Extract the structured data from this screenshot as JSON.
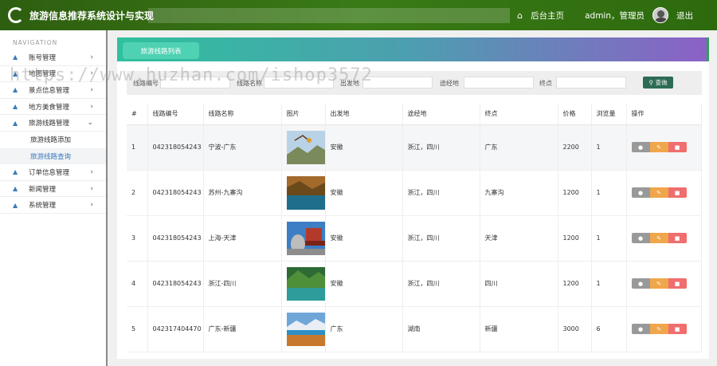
{
  "app": {
    "title": "旅游信息推荐系统设计与实现"
  },
  "topnav": {
    "home_label": "后台主页",
    "user_label": "admin，管理员",
    "logout_label": "退出"
  },
  "sidebar": {
    "nav_title": "NAVIGATION",
    "items": [
      {
        "label": "账号管理"
      },
      {
        "label": "地图管理"
      },
      {
        "label": "景点信息管理"
      },
      {
        "label": "地方美食管理"
      },
      {
        "label": "旅游线路管理"
      }
    ],
    "subitems": [
      {
        "label": "旅游线路添加"
      },
      {
        "label": "旅游线路查询"
      }
    ],
    "items_after": [
      {
        "label": "订单信息管理"
      },
      {
        "label": "新闻管理"
      },
      {
        "label": "系统管理"
      }
    ]
  },
  "panel": {
    "tab_label": "旅游线路列表"
  },
  "search": {
    "route_no_label": "线路编号",
    "route_name_label": "线路名称",
    "origin_label": "出发地",
    "via_label": "途经地",
    "dest_label": "终点",
    "button_label": "查询",
    "button_icon": "search-icon"
  },
  "table": {
    "headers": [
      "#",
      "线路编号",
      "线路名称",
      "图片",
      "出发地",
      "途经地",
      "终点",
      "价格",
      "浏览量",
      "操作"
    ],
    "rows": [
      {
        "idx": "1",
        "no": "042318054243",
        "name": "宁波-广东",
        "origin": "安徽",
        "via": "浙江，四川",
        "dest": "广东",
        "price": "2200",
        "views": "1"
      },
      {
        "idx": "2",
        "no": "042318054243",
        "name": "苏州-九寨沟",
        "origin": "安徽",
        "via": "浙江，四川",
        "dest": "九寨沟",
        "price": "1200",
        "views": "1"
      },
      {
        "idx": "3",
        "no": "042318054243",
        "name": "上海-天津",
        "origin": "安徽",
        "via": "浙江，四川",
        "dest": "天津",
        "price": "1200",
        "views": "1"
      },
      {
        "idx": "4",
        "no": "042318054243",
        "name": "浙江-四川",
        "origin": "安徽",
        "via": "浙江，四川",
        "dest": "四川",
        "price": "1200",
        "views": "1"
      },
      {
        "idx": "5",
        "no": "042317404470",
        "name": "广东-新疆",
        "origin": "广东",
        "via": "湖南",
        "dest": "新疆",
        "price": "3000",
        "views": "6"
      }
    ]
  },
  "watermark": "https://www.huzhan.com/ishop3572",
  "colors": {
    "topbar": "#3a7a16",
    "accent_blue": "#3b7ab8",
    "search_button": "#2e6b55",
    "op_gray": "#999999",
    "op_orange": "#f0a64a",
    "op_red": "#f06e6e"
  }
}
